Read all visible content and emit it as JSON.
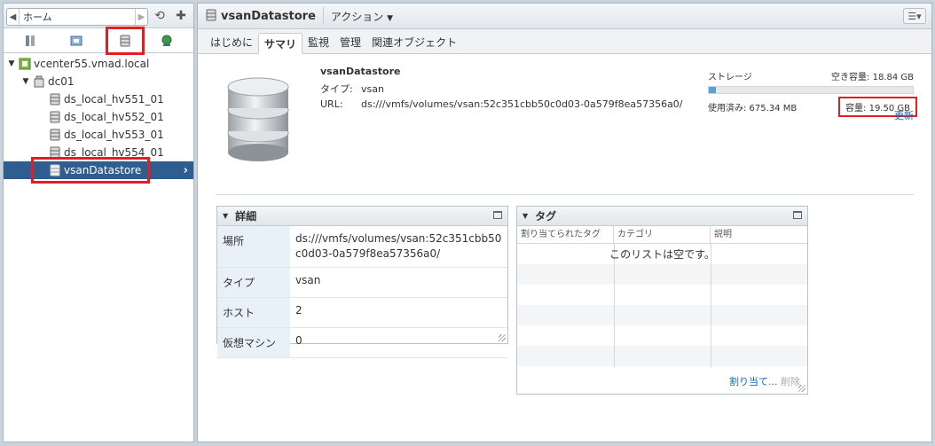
{
  "nav": {
    "home_label": "ホーム"
  },
  "tree": {
    "vcenter": "vcenter55.vmad.local",
    "datacenter": "dc01",
    "datastores": [
      "ds_local_hv551_01",
      "ds_local_hv552_01",
      "ds_local_hv553_01",
      "ds_local_hv554_01"
    ],
    "selected": "vsanDatastore"
  },
  "header": {
    "title": "vsanDatastore",
    "actions": "アクション"
  },
  "tabs": [
    "はじめに",
    "サマリ",
    "監視",
    "管理",
    "関連オブジェクト"
  ],
  "summary": {
    "name": "vsanDatastore",
    "type_label": "タイプ:",
    "type_value": "vsan",
    "url_label": "URL:",
    "url_value": "ds:///vmfs/volumes/vsan:52c351cbb50c0d03-0a579f8ea57356a0/"
  },
  "storage": {
    "label": "ストレージ",
    "free": "空き容量: 18.84 GB",
    "used": "使用済み: 675.34 MB",
    "capacity": "容量: 19.50 GB",
    "used_fraction": 0.034,
    "refresh": "更新"
  },
  "details": {
    "title": "詳細",
    "rows": [
      {
        "k": "場所",
        "v": "ds:///vmfs/volumes/vsan:52c351cbb50c0d03-0a579f8ea57356a0/"
      },
      {
        "k": "タイプ",
        "v": "vsan"
      },
      {
        "k": "ホスト",
        "v": "2"
      },
      {
        "k": "仮想マシン",
        "v": "0"
      }
    ]
  },
  "tags": {
    "title": "タグ",
    "columns": [
      "割り当てられたタグ",
      "カテゴリ",
      "説明"
    ],
    "empty": "このリストは空です。",
    "assign": "割り当て...",
    "remove": "削除"
  },
  "colors": {
    "accent": "#2f5d8f",
    "highlight": "#e02020",
    "link": "#1b68b8"
  }
}
